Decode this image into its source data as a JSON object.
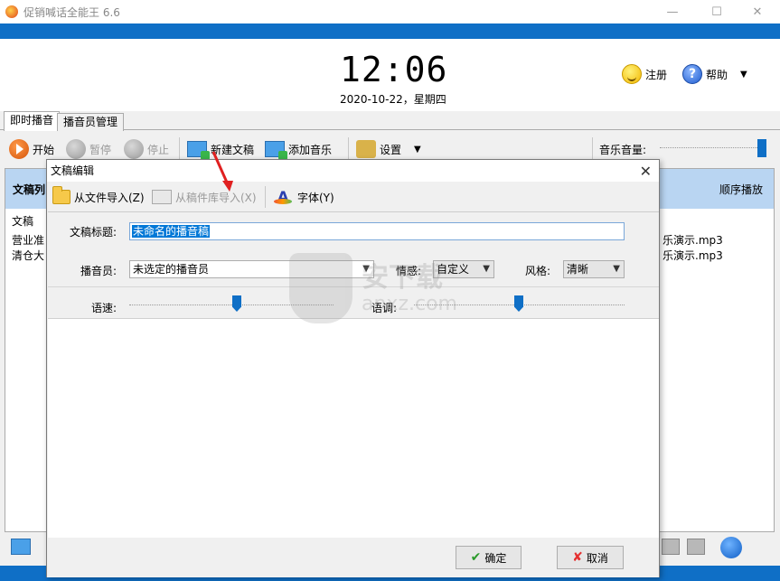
{
  "window": {
    "title": "促销喊话全能王 6.6",
    "minimize": "—",
    "maximize": "☐",
    "close": "✕"
  },
  "header": {
    "time": "12:06",
    "date": "2020-10-22，星期四",
    "register_label": "注册",
    "help_label": "帮助",
    "help_glyph": "?"
  },
  "tabs": [
    {
      "label": "即时播音"
    },
    {
      "label": "播音员管理"
    }
  ],
  "toolbar": {
    "start": "开始",
    "pause": "暂停",
    "stop": "停止",
    "new_script": "新建文稿",
    "add_music": "添加音乐",
    "settings": "设置",
    "music_volume": "音乐音量:"
  },
  "list": {
    "header_left": "文稿列",
    "header_right": "顺序播放",
    "col_label": "文稿",
    "rows": [
      "营业准",
      "清仓大"
    ],
    "music_rows": [
      "乐演示.mp3",
      "乐演示.mp3"
    ]
  },
  "dialog": {
    "title": "文稿编辑",
    "close": "✕",
    "toolbar": {
      "import_file": "从文件导入(Z)",
      "import_library": "从稿件库导入(X)",
      "font": "字体(Y)"
    },
    "form": {
      "title_label": "文稿标题:",
      "title_value": "未命名的播音稿",
      "announcer_label": "播音员:",
      "announcer_value": "未选定的播音员",
      "emotion_label": "情感:",
      "emotion_value": "自定义",
      "style_label": "风格:",
      "style_value": "清晰",
      "speed_label": "语速:",
      "pitch_label": "语调:"
    },
    "ok": "确定",
    "cancel": "取消"
  },
  "watermark": {
    "text": "安下载",
    "sub": "anxz.com"
  },
  "colors": {
    "accent": "#0f6fc6",
    "list_header": "#b9d5f2"
  }
}
